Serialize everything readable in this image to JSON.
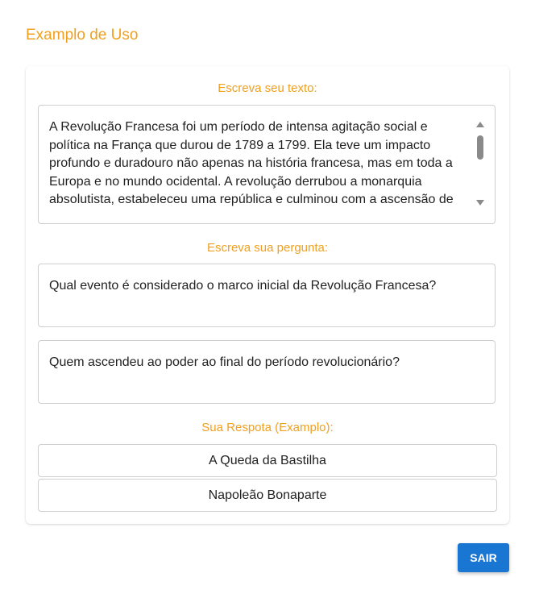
{
  "header": {
    "title": "Examplo de Uso"
  },
  "form": {
    "text_label": "Escreva seu texto:",
    "text_value": "A Revolução Francesa foi um período de intensa agitação social e política na França que durou de 1789 a 1799. Ela teve um impacto profundo e duradouro não apenas na história francesa, mas em toda a Europa e no mundo ocidental. A revolução derrubou a monarquia absolutista, estabeleceu uma república e culminou com a ascensão de",
    "question_label": "Escreva sua pergunta:",
    "questions": [
      "Qual evento é considerado o marco inicial da Revolução Francesa?",
      "Quem ascendeu ao poder ao final do período revolucionário?"
    ],
    "answer_label": "Sua Respota (Examplo):",
    "answers": [
      "A Queda da Bastilha",
      "Napoleão Bonaparte"
    ]
  },
  "actions": {
    "exit_label": "SAIR"
  },
  "colors": {
    "accent": "#f0a020",
    "primary_button": "#1976d2"
  }
}
